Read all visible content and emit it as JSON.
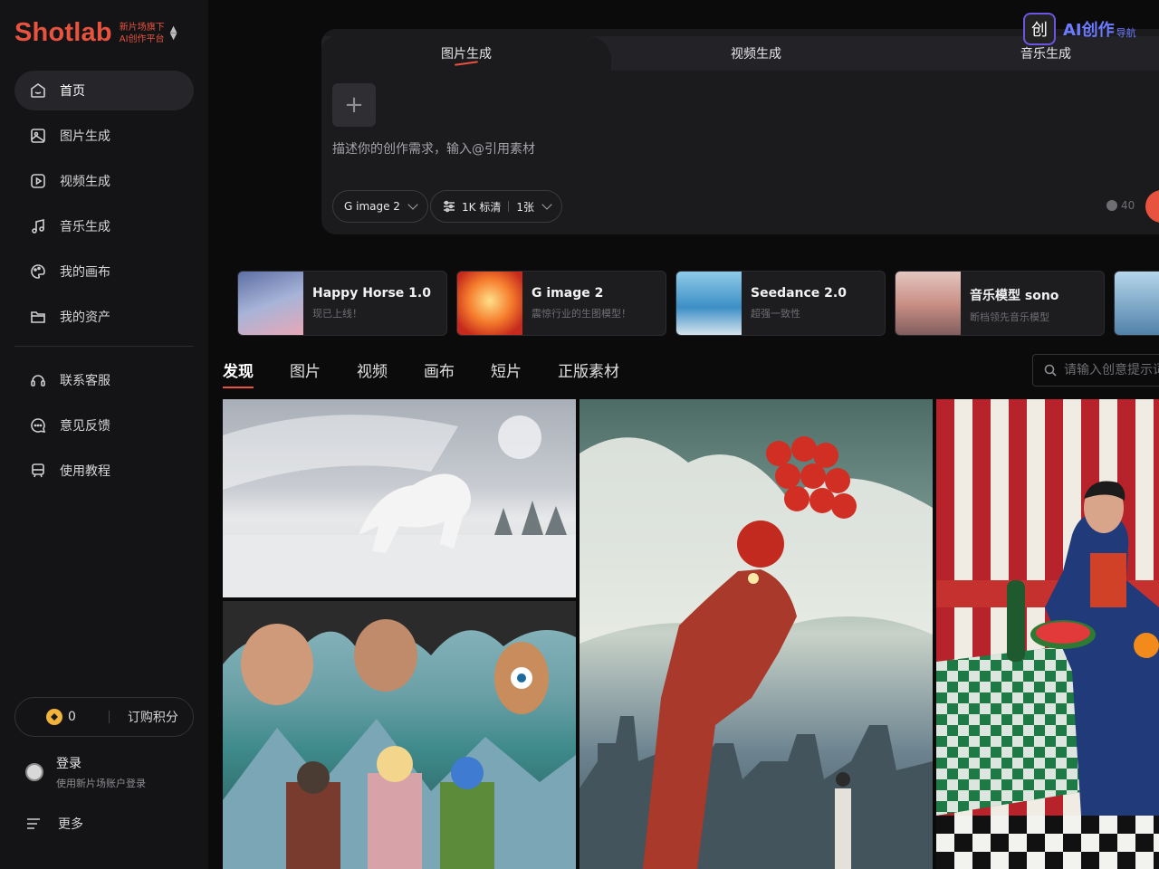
{
  "brand": {
    "logo": "Shotlab",
    "sub_line1": "新片场旗下",
    "sub_line2": "AI创作平台",
    "switch_icon": "chevron-up-down-icon"
  },
  "nav": {
    "items": [
      {
        "label": "首页",
        "icon": "home-icon",
        "active": true
      },
      {
        "label": "图片生成",
        "icon": "image-icon"
      },
      {
        "label": "视频生成",
        "icon": "video-icon"
      },
      {
        "label": "音乐生成",
        "icon": "music-icon"
      },
      {
        "label": "我的画布",
        "icon": "palette-icon"
      },
      {
        "label": "我的资产",
        "icon": "folder-icon"
      }
    ],
    "support": [
      {
        "label": "联系客服",
        "icon": "headset-icon"
      },
      {
        "label": "意见反馈",
        "icon": "chat-icon"
      },
      {
        "label": "使用教程",
        "icon": "tutorial-icon"
      }
    ]
  },
  "points": {
    "value": "0",
    "buy_label": "订购积分"
  },
  "login": {
    "title": "登录",
    "subtitle": "使用新片场账户登录"
  },
  "more": {
    "label": "更多"
  },
  "composer": {
    "tabs": [
      {
        "label": "图片生成",
        "active": true
      },
      {
        "label": "视频生成"
      },
      {
        "label": "音乐生成"
      }
    ],
    "placeholder": "描述你的创作需求，输入@引用素材",
    "model": "G image 2",
    "quality": "1K 标清",
    "count": "1张",
    "cost": "40"
  },
  "watermark": {
    "text": "AI创作",
    "sub": "导航"
  },
  "promos": [
    {
      "title": "Happy Horse 1.0",
      "subtitle": "现已上线！"
    },
    {
      "title": "G image 2",
      "subtitle": "震惊行业的生图模型！"
    },
    {
      "title": "Seedance 2.0",
      "subtitle": "超强一致性"
    },
    {
      "title": "音乐模型 sono",
      "subtitle": "断档领先音乐模型"
    }
  ],
  "categories": [
    {
      "label": "发现",
      "active": true
    },
    {
      "label": "图片"
    },
    {
      "label": "视频"
    },
    {
      "label": "画布"
    },
    {
      "label": "短片"
    },
    {
      "label": "正版素材"
    }
  ],
  "search": {
    "placeholder": "请输入创意提示词"
  },
  "colors": {
    "accent": "#e8533f",
    "sidebar_bg": "#141416",
    "page_bg": "#0b0b0c"
  }
}
